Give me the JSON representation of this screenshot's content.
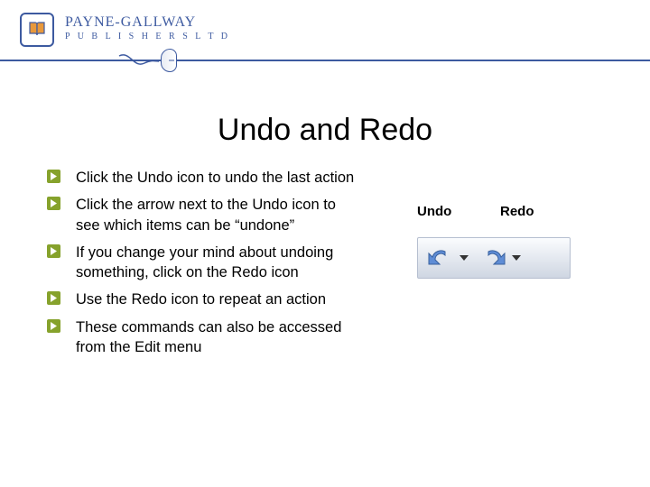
{
  "brand": {
    "name": "PAYNE-GALLWAY",
    "subtitle": "P U B L I S H E R S   L T D"
  },
  "title": "Undo and Redo",
  "bullets": [
    "Click the Undo icon to undo the last action",
    "Click the arrow next to the Undo icon to see which items can be “undone”",
    "If you change your mind about undoing something, click on the Redo icon",
    "Use the Redo icon to repeat an action",
    "These commands can also be accessed from the Edit menu"
  ],
  "toolbar": {
    "undo_label": "Undo",
    "redo_label": "Redo"
  }
}
